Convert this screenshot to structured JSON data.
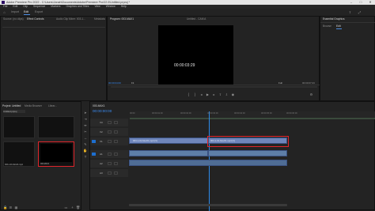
{
  "app": {
    "title": "Adobe Premiere Pro 2022 - C:\\Users\\Jonah\\Documents\\Adobe\\Premiere Pro\\22.0\\Untitled.prproj *"
  },
  "menu": [
    "File",
    "Edit",
    "Clip",
    "Sequence",
    "Markers",
    "Graphics and Titles",
    "View",
    "Window",
    "Help"
  ],
  "workspaces": [
    "Import",
    "Edit",
    "Export"
  ],
  "source_panel": {
    "tabs": [
      "Source: (no clips)",
      "Effect Controls",
      "Audio Clip Mixer: 003-1...",
      "Metadata"
    ]
  },
  "program_panel": {
    "tab": "Program: 003-MAX1",
    "center_label": "Untitled - CAM A",
    "timecode": "00:00:03:29",
    "in_point": "00:00:04:00",
    "fit": "Fit",
    "duration": "00:00:07:23",
    "quality": "Full"
  },
  "essential": {
    "title": "Essential Graphics",
    "tabs": [
      "Browse",
      "Edit"
    ]
  },
  "project_panel": {
    "title": "Project: Untitled",
    "tabs": [
      "Project: Untitled",
      "Media Browser",
      "Librar..."
    ],
    "search": "Untitled.prproj",
    "items": [
      {
        "name": "003-1-01-Mov01.mp4",
        "duration": "7:23"
      },
      {
        "name": "003-MAX1",
        "duration": "7:23"
      }
    ]
  },
  "timeline": {
    "tab": "003-MAX1",
    "timecode": "00:00:00:00",
    "ruler": [
      "00:00",
      "00:00:01:00",
      "00:00:02:00",
      "00:00:03:00",
      "00:00:04:00",
      "00:00:05:00",
      "00:00:06:00",
      "00:00:07:00"
    ],
    "tracks": [
      "V3",
      "V2",
      "V1",
      "A1",
      "A2",
      "A3"
    ],
    "clips": {
      "v1_a": "003-1-01-Mov01.mp4 [V]",
      "v1_b": "003-1-01-Mov01.mp4 [V]",
      "a1_a": "",
      "a1_b": ""
    }
  },
  "icons": [
    "selection-icon",
    "track-select-icon",
    "ripple-edit-icon",
    "razor-icon",
    "slip-icon",
    "pen-icon",
    "hand-icon",
    "type-icon"
  ],
  "colors": {
    "accent": "#2d8ceb",
    "highlight": "#e0252b",
    "clip_video": "#6f86bb"
  }
}
